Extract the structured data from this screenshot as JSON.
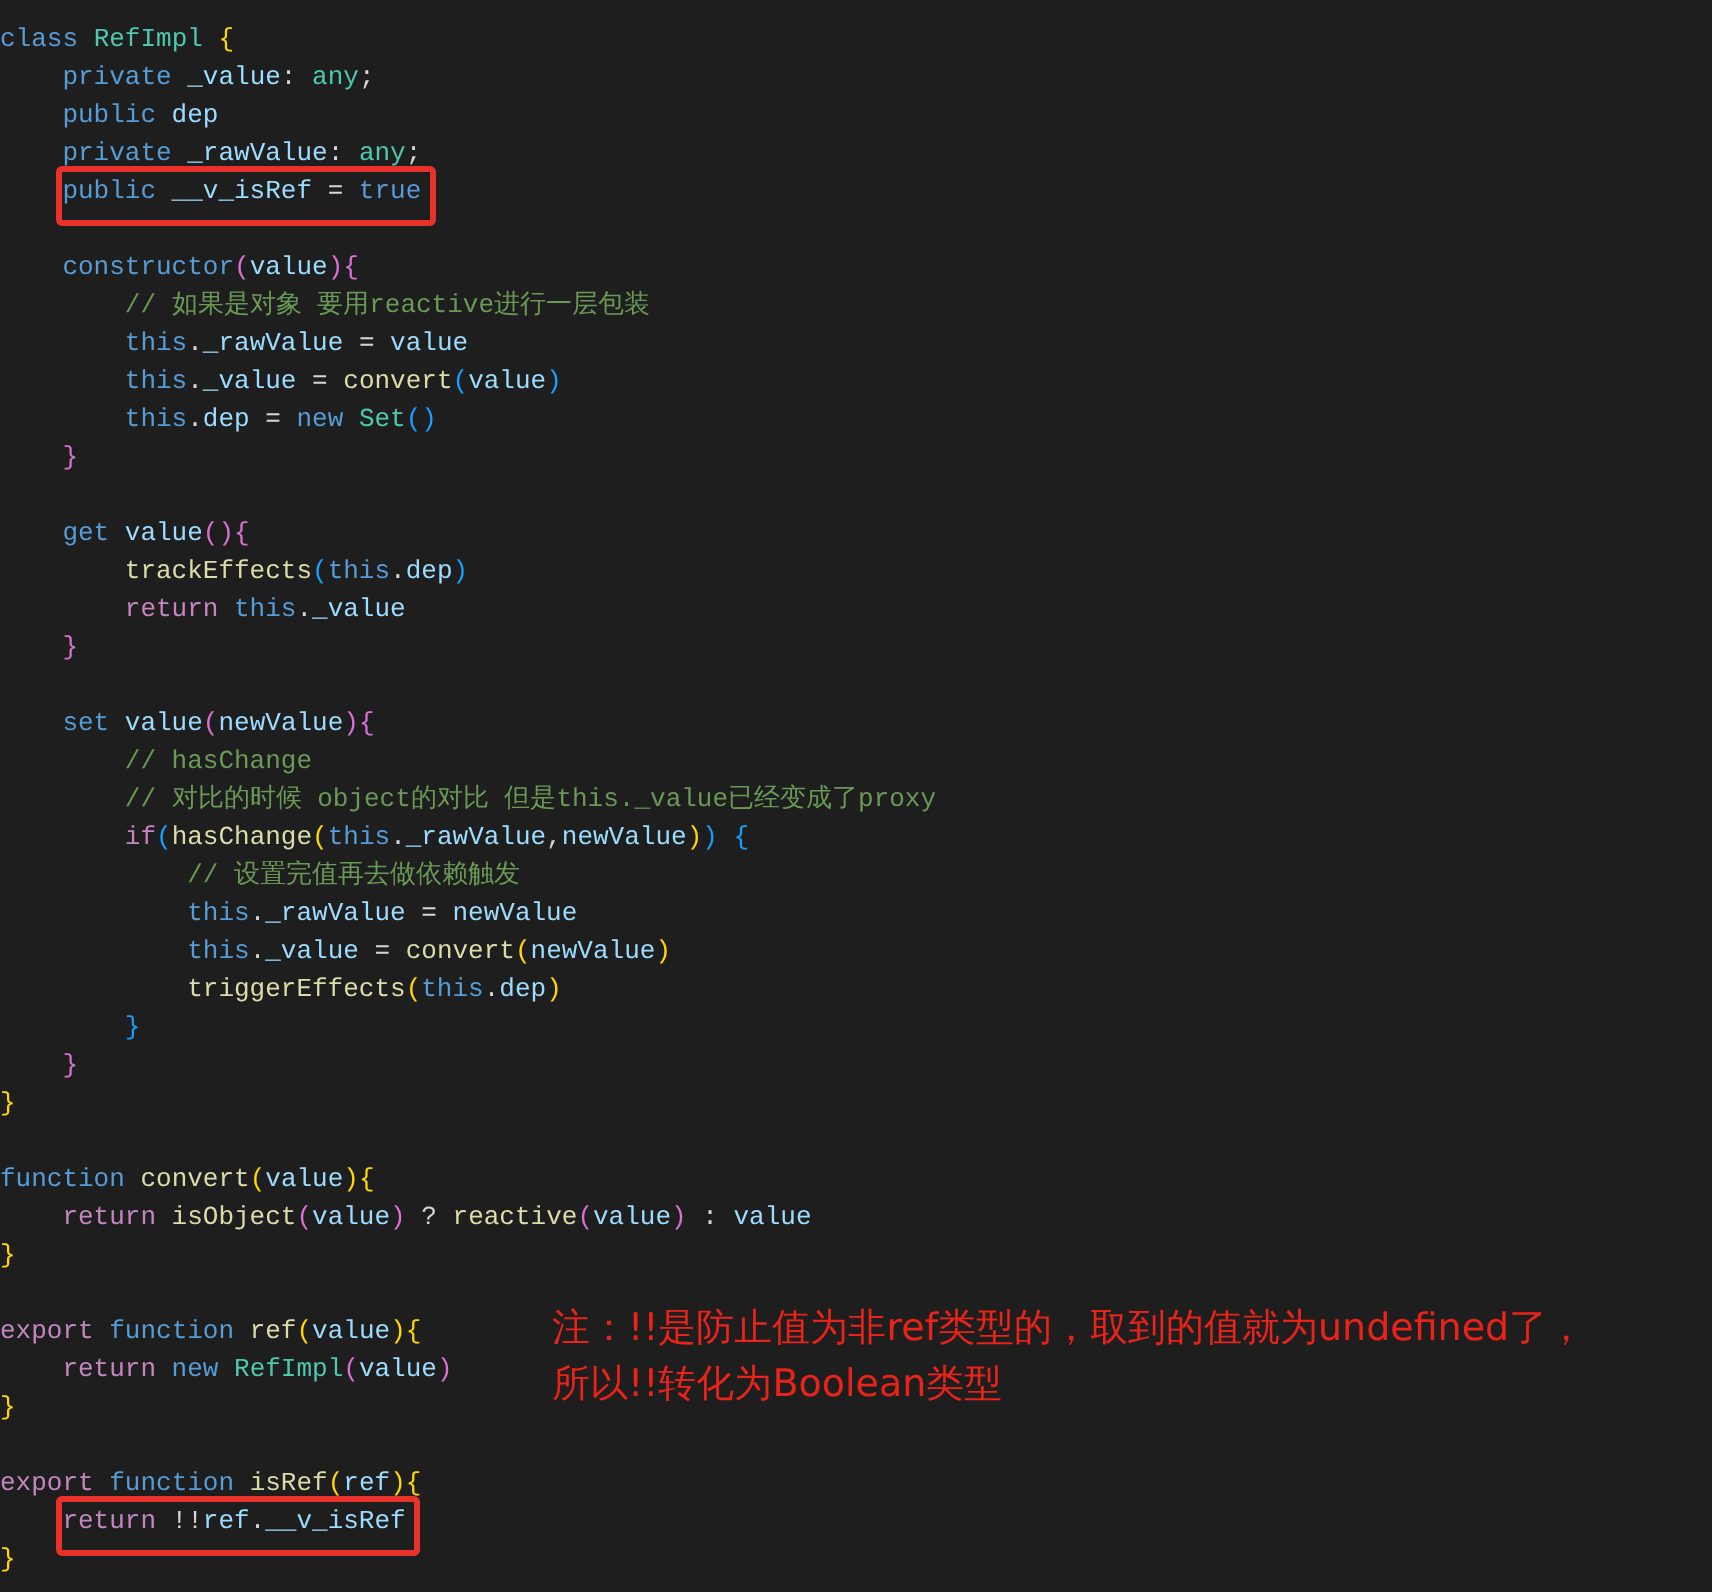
{
  "editor": {
    "lines": [
      {
        "kind": "code",
        "tokens": [
          {
            "text": "class ",
            "kind": "kw"
          },
          {
            "text": "RefImpl ",
            "kind": "cls"
          },
          {
            "text": "{",
            "kind": "b1"
          }
        ],
        "children": [
          {
            "kind": "code",
            "tokens": [
              {
                "text": "private ",
                "kind": "kw"
              },
              {
                "text": "_value",
                "kind": "var"
              },
              {
                "text": ": ",
                "kind": "txt"
              },
              {
                "text": "any",
                "kind": "cls"
              },
              {
                "text": ";",
                "kind": "txt"
              }
            ]
          },
          {
            "kind": "code",
            "tokens": [
              {
                "text": "public ",
                "kind": "kw"
              },
              {
                "text": "dep",
                "kind": "var"
              }
            ]
          },
          {
            "kind": "code",
            "tokens": [
              {
                "text": "private ",
                "kind": "kw"
              },
              {
                "text": "_rawValue",
                "kind": "var"
              },
              {
                "text": ": ",
                "kind": "txt"
              },
              {
                "text": "any",
                "kind": "cls"
              },
              {
                "text": ";",
                "kind": "txt"
              }
            ]
          },
          {
            "kind": "code",
            "boxed": true,
            "tokens": [
              {
                "text": "public ",
                "kind": "kw"
              },
              {
                "text": "__v_isRef",
                "kind": "var"
              },
              {
                "text": " = ",
                "kind": "txt"
              },
              {
                "text": "true",
                "kind": "kw"
              }
            ]
          },
          {
            "kind": "blank"
          },
          {
            "kind": "code",
            "tokens": [
              {
                "text": "constructor",
                "kind": "kw"
              },
              {
                "text": "(",
                "kind": "b2"
              },
              {
                "text": "value",
                "kind": "var"
              },
              {
                "text": ")",
                "kind": "b2"
              },
              {
                "text": "{",
                "kind": "b2"
              }
            ],
            "children": [
              {
                "kind": "code",
                "tokens": [
                  {
                    "text": "// 如果是对象 要用reactive进行一层包装",
                    "kind": "cmt"
                  }
                ]
              },
              {
                "kind": "code",
                "tokens": [
                  {
                    "text": "this",
                    "kind": "kw"
                  },
                  {
                    "text": ".",
                    "kind": "txt"
                  },
                  {
                    "text": "_rawValue",
                    "kind": "var"
                  },
                  {
                    "text": " = ",
                    "kind": "txt"
                  },
                  {
                    "text": "value",
                    "kind": "var"
                  }
                ]
              },
              {
                "kind": "code",
                "tokens": [
                  {
                    "text": "this",
                    "kind": "kw"
                  },
                  {
                    "text": ".",
                    "kind": "txt"
                  },
                  {
                    "text": "_value",
                    "kind": "var"
                  },
                  {
                    "text": " = ",
                    "kind": "txt"
                  },
                  {
                    "text": "convert",
                    "kind": "fn"
                  },
                  {
                    "text": "(",
                    "kind": "b3"
                  },
                  {
                    "text": "value",
                    "kind": "var"
                  },
                  {
                    "text": ")",
                    "kind": "b3"
                  }
                ]
              },
              {
                "kind": "code",
                "tokens": [
                  {
                    "text": "this",
                    "kind": "kw"
                  },
                  {
                    "text": ".",
                    "kind": "txt"
                  },
                  {
                    "text": "dep",
                    "kind": "var"
                  },
                  {
                    "text": " = ",
                    "kind": "txt"
                  },
                  {
                    "text": "new ",
                    "kind": "kw"
                  },
                  {
                    "text": "Set",
                    "kind": "cls"
                  },
                  {
                    "text": "()",
                    "kind": "b3"
                  }
                ]
              }
            ]
          },
          {
            "kind": "code",
            "tokens": [
              {
                "text": "}",
                "kind": "b2"
              }
            ]
          },
          {
            "kind": "blank"
          },
          {
            "kind": "code",
            "tokens": [
              {
                "text": "get ",
                "kind": "kw"
              },
              {
                "text": "value",
                "kind": "var"
              },
              {
                "text": "()",
                "kind": "b2"
              },
              {
                "text": "{",
                "kind": "b2"
              }
            ],
            "children": [
              {
                "kind": "code",
                "tokens": [
                  {
                    "text": "trackEffects",
                    "kind": "fn"
                  },
                  {
                    "text": "(",
                    "kind": "b3"
                  },
                  {
                    "text": "this",
                    "kind": "kw"
                  },
                  {
                    "text": ".",
                    "kind": "txt"
                  },
                  {
                    "text": "dep",
                    "kind": "var"
                  },
                  {
                    "text": ")",
                    "kind": "b3"
                  }
                ]
              },
              {
                "kind": "code",
                "tokens": [
                  {
                    "text": "return ",
                    "kind": "ctl"
                  },
                  {
                    "text": "this",
                    "kind": "kw"
                  },
                  {
                    "text": ".",
                    "kind": "txt"
                  },
                  {
                    "text": "_value",
                    "kind": "var"
                  }
                ]
              }
            ]
          },
          {
            "kind": "code",
            "tokens": [
              {
                "text": "}",
                "kind": "b2"
              }
            ]
          },
          {
            "kind": "blank"
          },
          {
            "kind": "code",
            "tokens": [
              {
                "text": "set ",
                "kind": "kw"
              },
              {
                "text": "value",
                "kind": "var"
              },
              {
                "text": "(",
                "kind": "b2"
              },
              {
                "text": "newValue",
                "kind": "var"
              },
              {
                "text": ")",
                "kind": "b2"
              },
              {
                "text": "{",
                "kind": "b2"
              }
            ],
            "children": [
              {
                "kind": "code",
                "tokens": [
                  {
                    "text": "// hasChange",
                    "kind": "cmt"
                  }
                ]
              },
              {
                "kind": "code",
                "tokens": [
                  {
                    "text": "// 对比的时候 object的对比 但是this._value已经变成了proxy",
                    "kind": "cmt"
                  }
                ]
              },
              {
                "kind": "code",
                "tokens": [
                  {
                    "text": "if",
                    "kind": "ctl"
                  },
                  {
                    "text": "(",
                    "kind": "b3"
                  },
                  {
                    "text": "hasChange",
                    "kind": "fn"
                  },
                  {
                    "text": "(",
                    "kind": "b1"
                  },
                  {
                    "text": "this",
                    "kind": "kw"
                  },
                  {
                    "text": ".",
                    "kind": "txt"
                  },
                  {
                    "text": "_rawValue",
                    "kind": "var"
                  },
                  {
                    "text": ",",
                    "kind": "txt"
                  },
                  {
                    "text": "newValue",
                    "kind": "var"
                  },
                  {
                    "text": ")",
                    "kind": "b1"
                  },
                  {
                    "text": ") {",
                    "kind": "b3"
                  }
                ],
                "children": [
                  {
                    "kind": "code",
                    "tokens": [
                      {
                        "text": "// 设置完值再去做依赖触发",
                        "kind": "cmt"
                      }
                    ]
                  },
                  {
                    "kind": "code",
                    "tokens": [
                      {
                        "text": "this",
                        "kind": "kw"
                      },
                      {
                        "text": ".",
                        "kind": "txt"
                      },
                      {
                        "text": "_rawValue",
                        "kind": "var"
                      },
                      {
                        "text": " = ",
                        "kind": "txt"
                      },
                      {
                        "text": "newValue",
                        "kind": "var"
                      }
                    ]
                  },
                  {
                    "kind": "code",
                    "tokens": [
                      {
                        "text": "this",
                        "kind": "kw"
                      },
                      {
                        "text": ".",
                        "kind": "txt"
                      },
                      {
                        "text": "_value",
                        "kind": "var"
                      },
                      {
                        "text": " = ",
                        "kind": "txt"
                      },
                      {
                        "text": "convert",
                        "kind": "fn"
                      },
                      {
                        "text": "(",
                        "kind": "b1"
                      },
                      {
                        "text": "newValue",
                        "kind": "var"
                      },
                      {
                        "text": ")",
                        "kind": "b1"
                      }
                    ]
                  },
                  {
                    "kind": "code",
                    "tokens": [
                      {
                        "text": "triggerEffects",
                        "kind": "fn"
                      },
                      {
                        "text": "(",
                        "kind": "b1"
                      },
                      {
                        "text": "this",
                        "kind": "kw"
                      },
                      {
                        "text": ".",
                        "kind": "txt"
                      },
                      {
                        "text": "dep",
                        "kind": "var"
                      },
                      {
                        "text": ")",
                        "kind": "b1"
                      }
                    ]
                  }
                ]
              },
              {
                "kind": "code",
                "tokens": [
                  {
                    "text": "}",
                    "kind": "b3"
                  }
                ]
              }
            ]
          },
          {
            "kind": "code",
            "tokens": [
              {
                "text": "}",
                "kind": "b2"
              }
            ]
          }
        ]
      },
      {
        "kind": "code",
        "tokens": [
          {
            "text": "}",
            "kind": "b1"
          }
        ]
      },
      {
        "kind": "blank"
      },
      {
        "kind": "code",
        "tokens": [
          {
            "text": "function ",
            "kind": "kw"
          },
          {
            "text": "convert",
            "kind": "fn"
          },
          {
            "text": "(",
            "kind": "b1"
          },
          {
            "text": "value",
            "kind": "var"
          },
          {
            "text": ")",
            "kind": "b1"
          },
          {
            "text": "{",
            "kind": "b1"
          }
        ],
        "children": [
          {
            "kind": "code",
            "tokens": [
              {
                "text": "return ",
                "kind": "ctl"
              },
              {
                "text": "isObject",
                "kind": "fn"
              },
              {
                "text": "(",
                "kind": "b2"
              },
              {
                "text": "value",
                "kind": "var"
              },
              {
                "text": ")",
                "kind": "b2"
              },
              {
                "text": " ? ",
                "kind": "txt"
              },
              {
                "text": "reactive",
                "kind": "fn"
              },
              {
                "text": "(",
                "kind": "b2"
              },
              {
                "text": "value",
                "kind": "var"
              },
              {
                "text": ")",
                "kind": "b2"
              },
              {
                "text": " : ",
                "kind": "txt"
              },
              {
                "text": "value",
                "kind": "var"
              }
            ]
          }
        ]
      },
      {
        "kind": "code",
        "tokens": [
          {
            "text": "}",
            "kind": "b1"
          }
        ]
      },
      {
        "kind": "blank"
      },
      {
        "kind": "code",
        "tokens": [
          {
            "text": "export ",
            "kind": "ctl"
          },
          {
            "text": "function ",
            "kind": "kw"
          },
          {
            "text": "ref",
            "kind": "fn"
          },
          {
            "text": "(",
            "kind": "b1"
          },
          {
            "text": "value",
            "kind": "var"
          },
          {
            "text": ")",
            "kind": "b1"
          },
          {
            "text": "{",
            "kind": "b1"
          }
        ],
        "children": [
          {
            "kind": "code",
            "tokens": [
              {
                "text": "return ",
                "kind": "ctl"
              },
              {
                "text": "new ",
                "kind": "kw"
              },
              {
                "text": "RefImpl",
                "kind": "cls"
              },
              {
                "text": "(",
                "kind": "b2"
              },
              {
                "text": "value",
                "kind": "var"
              },
              {
                "text": ")",
                "kind": "b2"
              }
            ]
          }
        ]
      },
      {
        "kind": "code",
        "tokens": [
          {
            "text": "}",
            "kind": "b1"
          }
        ]
      },
      {
        "kind": "blank"
      },
      {
        "kind": "code",
        "tokens": [
          {
            "text": "export ",
            "kind": "ctl"
          },
          {
            "text": "function ",
            "kind": "kw"
          },
          {
            "text": "isRef",
            "kind": "fn"
          },
          {
            "text": "(",
            "kind": "b1"
          },
          {
            "text": "ref",
            "kind": "var"
          },
          {
            "text": ")",
            "kind": "b1"
          },
          {
            "text": "{",
            "kind": "b1"
          }
        ],
        "children": [
          {
            "kind": "code",
            "boxed": true,
            "tokens": [
              {
                "text": "return ",
                "kind": "ctl"
              },
              {
                "text": "!!",
                "kind": "txt"
              },
              {
                "text": "ref",
                "kind": "var"
              },
              {
                "text": ".",
                "kind": "txt"
              },
              {
                "text": "__v_isRef",
                "kind": "var"
              }
            ]
          }
        ]
      },
      {
        "kind": "code",
        "tokens": [
          {
            "text": "}",
            "kind": "b1"
          }
        ]
      }
    ]
  },
  "annotation": {
    "lines": [
      "注：!!是防止值为非ref类型的，取到的值就为undefined了，",
      "所以!!转化为Boolean类型"
    ]
  }
}
